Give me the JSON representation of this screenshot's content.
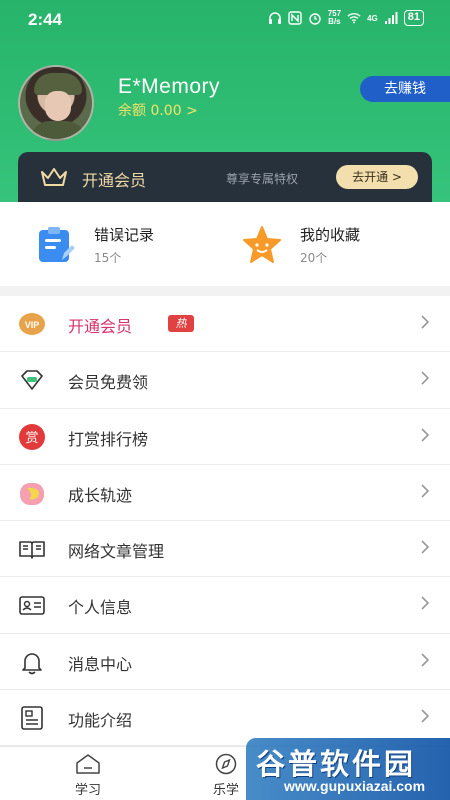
{
  "status_bar": {
    "time": "2:44",
    "net_speed_top": "757",
    "net_speed_bottom": "B/s",
    "signal": "4G",
    "battery": "81"
  },
  "profile": {
    "username": "E*Memory",
    "balance": "余额 0.00 >",
    "earn_button": "去赚钱"
  },
  "vip_bar": {
    "title": "开通会员",
    "subtitle": "尊享专属特权",
    "button": "去开通 >"
  },
  "shortcuts": [
    {
      "title": "错误记录",
      "count": "15个",
      "icon": "clipboard-icon"
    },
    {
      "title": "我的收藏",
      "count": "20个",
      "icon": "star-icon"
    }
  ],
  "menu": [
    {
      "label": "开通会员",
      "icon": "vip-icon",
      "badge": "热",
      "highlight": true
    },
    {
      "label": "会员免费领",
      "icon": "diamond-icon"
    },
    {
      "label": "打赏排行榜",
      "icon": "reward-icon",
      "icon_text": "赏"
    },
    {
      "label": "成长轨迹",
      "icon": "growth-icon"
    },
    {
      "label": "网络文章管理",
      "icon": "book-icon"
    },
    {
      "label": "个人信息",
      "icon": "id-card-icon"
    },
    {
      "label": "消息中心",
      "icon": "bell-icon"
    },
    {
      "label": "功能介绍",
      "icon": "document-icon"
    }
  ],
  "tabs": [
    {
      "label": "学习",
      "icon": "home-icon"
    },
    {
      "label": "乐学",
      "icon": "compass-icon"
    }
  ],
  "watermark": {
    "title": "谷普软件园",
    "url": "www.gupuxiazai.com"
  },
  "colors": {
    "header_green": "#2fbd74",
    "earn_blue": "#1f5fc7",
    "vip_dark": "#27313c",
    "vip_gold": "#f3deae",
    "hot_red": "#e24141",
    "balance_yellow": "#f3e36a"
  }
}
